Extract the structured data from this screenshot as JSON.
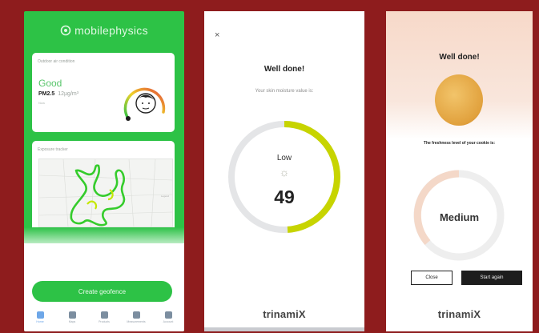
{
  "background_color": "#8e1c1d",
  "phone1": {
    "accent": "#2dc246",
    "logo_text": "mobilephysics",
    "air_quality": {
      "card_title": "Outdoor air condition",
      "status": "Good",
      "pm_label": "PM2.5",
      "pm_value": "12µg/m³",
      "sub": "Now"
    },
    "map": {
      "card_title": "Exposure tracker",
      "note": "Legend"
    },
    "cta_label": "Create geofence",
    "tabs": [
      {
        "label": "Home",
        "icon": "home-icon",
        "active": true
      },
      {
        "label": "Maps",
        "icon": "map-icon",
        "active": false
      },
      {
        "label": "Products",
        "icon": "products-icon",
        "active": false
      },
      {
        "label": "Measurements",
        "icon": "chart-icon",
        "active": false
      },
      {
        "label": "Account",
        "icon": "account-icon",
        "active": false
      }
    ]
  },
  "phone2": {
    "close_glyph": "×",
    "title": "Well done!",
    "subtitle": "Your skin moisture value is:",
    "level_label": "Low",
    "value": "49",
    "ring_fraction": 0.49,
    "ring_color": "#c7d400",
    "brand": "trinamiX"
  },
  "phone3": {
    "title": "Well done!",
    "subtitle": "The freshness level of your cookie is:",
    "level_label": "Medium",
    "ring_color": "#f4d8c8",
    "close_label": "Close",
    "again_label": "Start again",
    "brand": "trinamiX"
  }
}
